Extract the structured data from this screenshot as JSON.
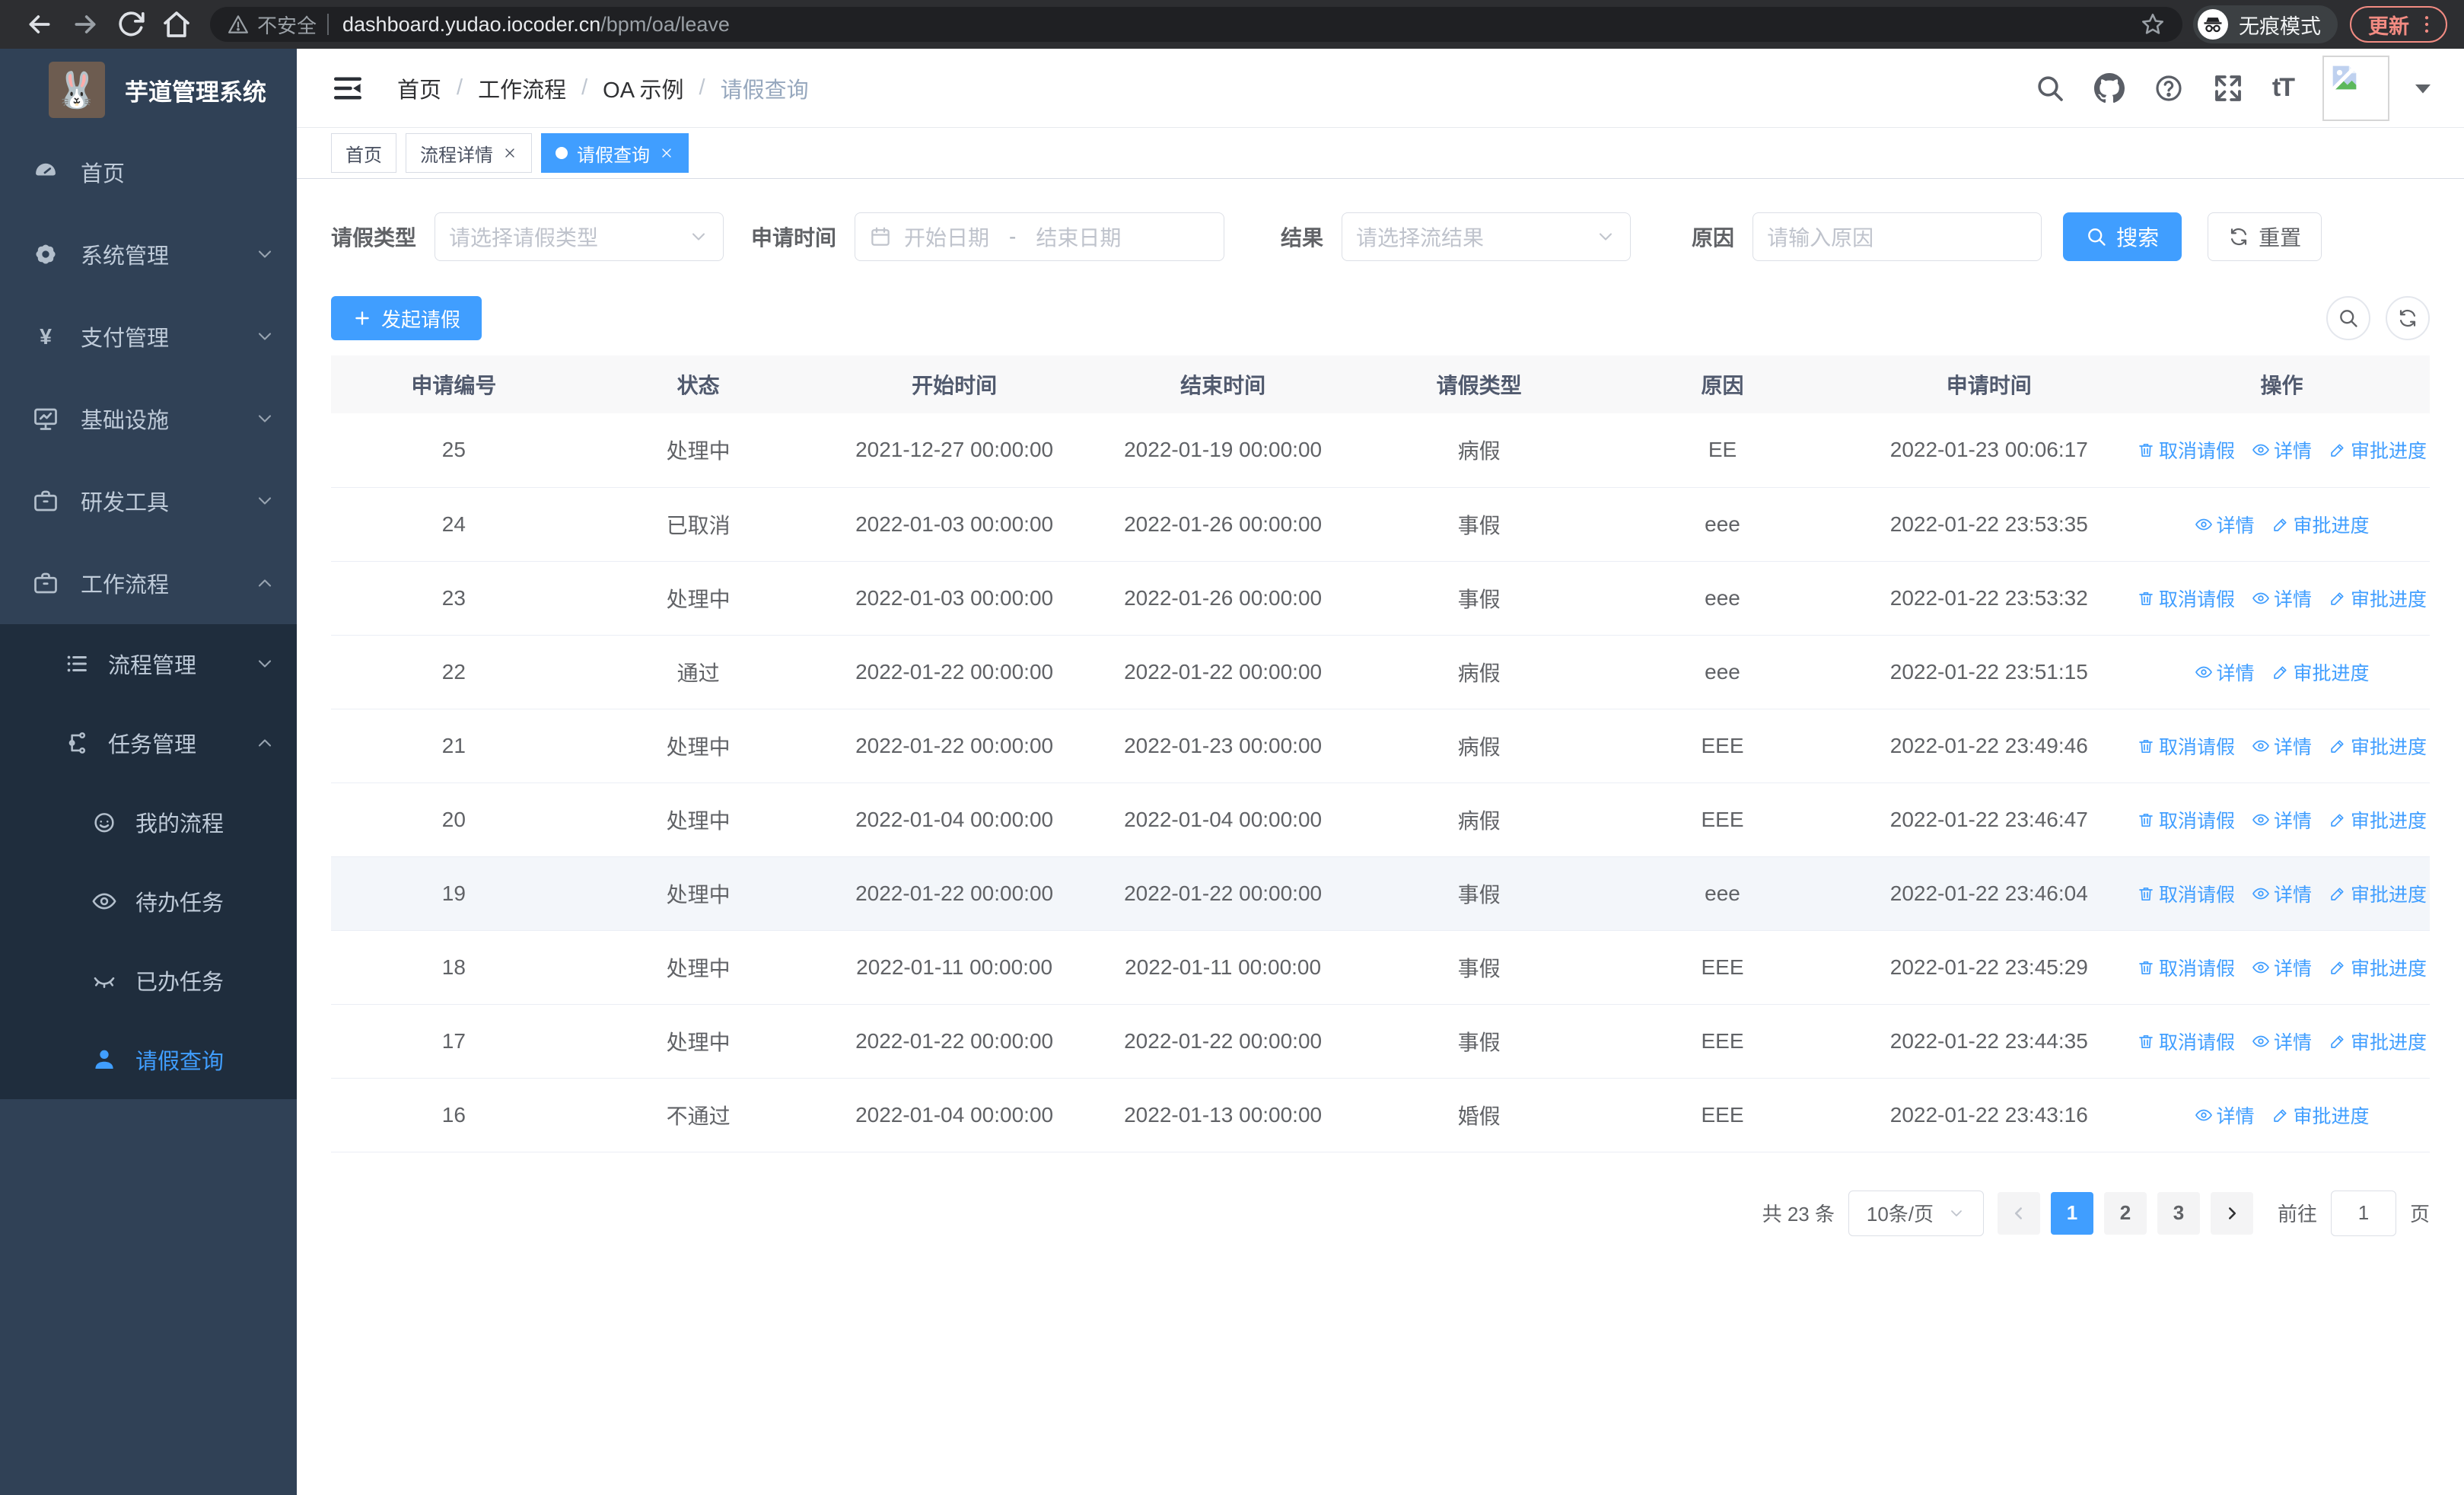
{
  "browser": {
    "security_label": "不安全",
    "url_host": "dashboard.yudao.iocoder.cn",
    "url_path": "/bpm/oa/leave",
    "incognito_label": "无痕模式",
    "update_label": "更新"
  },
  "sidebar": {
    "app_title": "芋道管理系统",
    "logo_glyph": "🐰",
    "menu": [
      {
        "key": "home",
        "label": "首页",
        "icon": "dashboard"
      },
      {
        "key": "system",
        "label": "系统管理",
        "icon": "gear",
        "arrow": "down"
      },
      {
        "key": "payment",
        "label": "支付管理",
        "icon": "yen",
        "arrow": "down"
      },
      {
        "key": "infrastructure",
        "label": "基础设施",
        "icon": "monitor",
        "arrow": "down"
      },
      {
        "key": "dev-tools",
        "label": "研发工具",
        "icon": "toolbox",
        "arrow": "down"
      },
      {
        "key": "workflow",
        "label": "工作流程",
        "icon": "briefcase",
        "arrow": "up",
        "children": [
          {
            "key": "process-mgmt",
            "label": "流程管理",
            "icon": "list",
            "arrow": "down"
          },
          {
            "key": "task-mgmt",
            "label": "任务管理",
            "icon": "flow",
            "arrow": "up",
            "children": [
              {
                "key": "my-process",
                "label": "我的流程",
                "icon": "face"
              },
              {
                "key": "todo-tasks",
                "label": "待办任务",
                "icon": "eye"
              },
              {
                "key": "done-tasks",
                "label": "已办任务",
                "icon": "eye-closed"
              },
              {
                "key": "leave-query",
                "label": "请假查询",
                "icon": "user",
                "active": true
              }
            ]
          }
        ]
      }
    ]
  },
  "header": {
    "breadcrumb": [
      "首页",
      "工作流程",
      "OA 示例",
      "请假查询"
    ],
    "breadcrumb_separator": "/",
    "fontsize_glyph": "tT"
  },
  "tabs": [
    {
      "key": "home",
      "label": "首页",
      "closable": false,
      "active": false
    },
    {
      "key": "process-detail",
      "label": "流程详情",
      "closable": true,
      "active": false
    },
    {
      "key": "leave-query",
      "label": "请假查询",
      "closable": true,
      "active": true
    }
  ],
  "filters": {
    "type": {
      "label": "请假类型",
      "placeholder": "请选择请假类型"
    },
    "time": {
      "label": "申请时间",
      "start_placeholder": "开始日期",
      "separator": "-",
      "end_placeholder": "结束日期"
    },
    "result": {
      "label": "结果",
      "placeholder": "请选择流结果"
    },
    "reason": {
      "label": "原因",
      "placeholder": "请输入原因"
    },
    "search_label": "搜索",
    "reset_label": "重置"
  },
  "toolbar": {
    "create_label": "发起请假"
  },
  "table": {
    "columns": [
      "申请编号",
      "状态",
      "开始时间",
      "结束时间",
      "请假类型",
      "原因",
      "申请时间",
      "操作"
    ],
    "row_actions": {
      "cancel": "取消请假",
      "detail": "详情",
      "progress": "审批进度"
    },
    "rows": [
      {
        "id": "25",
        "status": "处理中",
        "start": "2021-12-27 00:00:00",
        "end": "2022-01-19 00:00:00",
        "type": "病假",
        "reason": "EE",
        "applied": "2022-01-23 00:06:17",
        "actions": [
          "cancel",
          "detail",
          "progress"
        ],
        "highlight": false
      },
      {
        "id": "24",
        "status": "已取消",
        "start": "2022-01-03 00:00:00",
        "end": "2022-01-26 00:00:00",
        "type": "事假",
        "reason": "eee",
        "applied": "2022-01-22 23:53:35",
        "actions": [
          "detail",
          "progress"
        ],
        "highlight": false
      },
      {
        "id": "23",
        "status": "处理中",
        "start": "2022-01-03 00:00:00",
        "end": "2022-01-26 00:00:00",
        "type": "事假",
        "reason": "eee",
        "applied": "2022-01-22 23:53:32",
        "actions": [
          "cancel",
          "detail",
          "progress"
        ],
        "highlight": false
      },
      {
        "id": "22",
        "status": "通过",
        "start": "2022-01-22 00:00:00",
        "end": "2022-01-22 00:00:00",
        "type": "病假",
        "reason": "eee",
        "applied": "2022-01-22 23:51:15",
        "actions": [
          "detail",
          "progress"
        ],
        "highlight": false
      },
      {
        "id": "21",
        "status": "处理中",
        "start": "2022-01-22 00:00:00",
        "end": "2022-01-23 00:00:00",
        "type": "病假",
        "reason": "EEE",
        "applied": "2022-01-22 23:49:46",
        "actions": [
          "cancel",
          "detail",
          "progress"
        ],
        "highlight": false
      },
      {
        "id": "20",
        "status": "处理中",
        "start": "2022-01-04 00:00:00",
        "end": "2022-01-04 00:00:00",
        "type": "病假",
        "reason": "EEE",
        "applied": "2022-01-22 23:46:47",
        "actions": [
          "cancel",
          "detail",
          "progress"
        ],
        "highlight": false
      },
      {
        "id": "19",
        "status": "处理中",
        "start": "2022-01-22 00:00:00",
        "end": "2022-01-22 00:00:00",
        "type": "事假",
        "reason": "eee",
        "applied": "2022-01-22 23:46:04",
        "actions": [
          "cancel",
          "detail",
          "progress"
        ],
        "highlight": true
      },
      {
        "id": "18",
        "status": "处理中",
        "start": "2022-01-11 00:00:00",
        "end": "2022-01-11 00:00:00",
        "type": "事假",
        "reason": "EEE",
        "applied": "2022-01-22 23:45:29",
        "actions": [
          "cancel",
          "detail",
          "progress"
        ],
        "highlight": false
      },
      {
        "id": "17",
        "status": "处理中",
        "start": "2022-01-22 00:00:00",
        "end": "2022-01-22 00:00:00",
        "type": "事假",
        "reason": "EEE",
        "applied": "2022-01-22 23:44:35",
        "actions": [
          "cancel",
          "detail",
          "progress"
        ],
        "highlight": false
      },
      {
        "id": "16",
        "status": "不通过",
        "start": "2022-01-04 00:00:00",
        "end": "2022-01-13 00:00:00",
        "type": "婚假",
        "reason": "EEE",
        "applied": "2022-01-22 23:43:16",
        "actions": [
          "detail",
          "progress"
        ],
        "highlight": false
      }
    ]
  },
  "pagination": {
    "total_label": "共 23 条",
    "page_size_label": "10条/页",
    "pages": [
      "1",
      "2",
      "3"
    ],
    "active_page": "1",
    "goto_label": "前往",
    "goto_value": "1",
    "page_unit_label": "页"
  },
  "colors": {
    "accent": "#409eff",
    "sidebar_bg": "#304156",
    "submenu_bg": "#1f2d3d",
    "update_accent": "#f28b82"
  }
}
